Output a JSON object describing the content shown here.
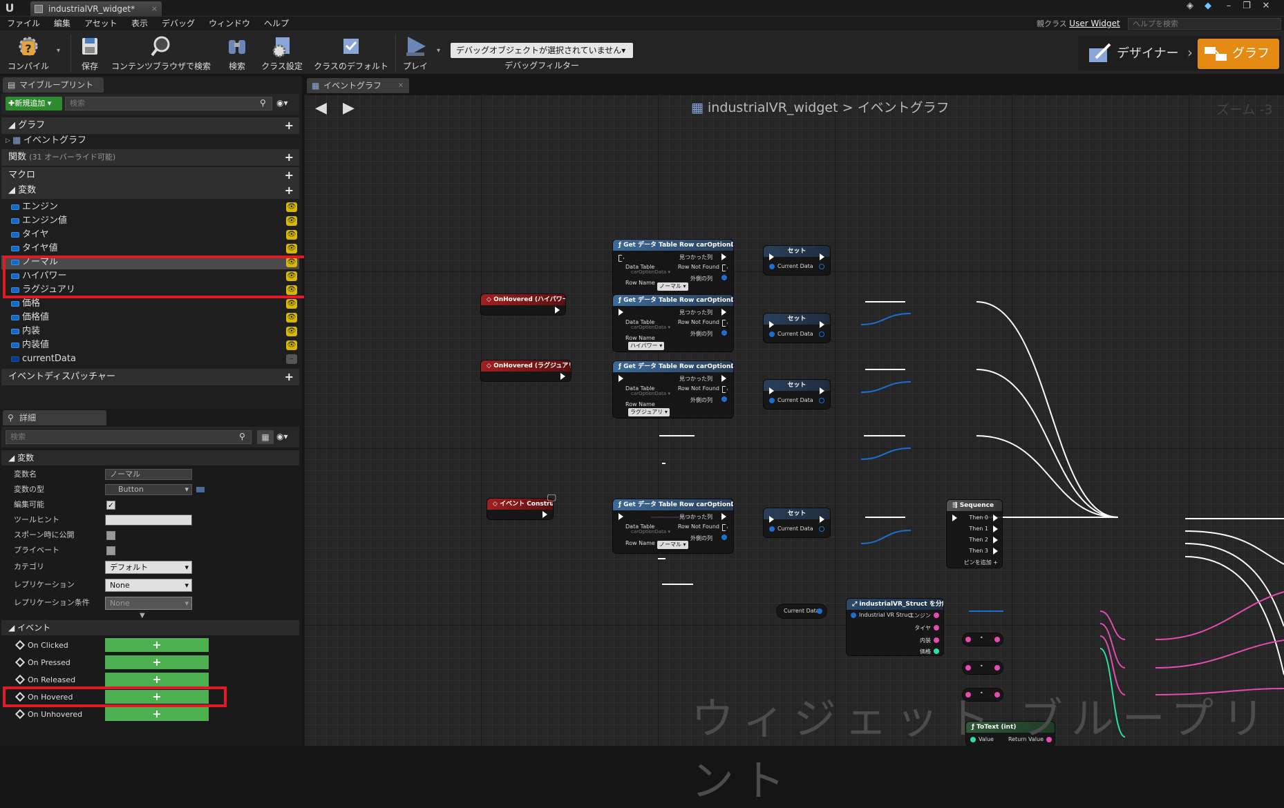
{
  "window": {
    "tab_title": "industrialVR_widget*",
    "close": "×"
  },
  "menu": [
    "ファイル",
    "編集",
    "アセット",
    "表示",
    "デバッグ",
    "ウィンドウ",
    "ヘルプ"
  ],
  "parent_class": {
    "label": "親クラス",
    "value": "User Widget"
  },
  "help_search_placeholder": "ヘルプを検索",
  "toolbar": {
    "compile": "コンパイル",
    "save": "保存",
    "content_browser": "コンテンツブラウザで検索",
    "search": "検索",
    "class_settings": "クラス設定",
    "class_defaults": "クラスのデフォルト",
    "play": "プレイ",
    "debug_select": "デバッグオブジェクトが選択されていません▾",
    "debug_filter": "デバッグフィルター"
  },
  "modes": {
    "designer": "デザイナー",
    "graph": "グラフ",
    "accent": "#e58b14"
  },
  "my_blueprint": {
    "tab": "マイブループリント",
    "add_new": "新規追加",
    "search_placeholder": "検索",
    "graphs_header": "グラフ",
    "event_graph": "イベントグラフ",
    "functions_header": "関数",
    "functions_note": "(31 オーバーライド可能)",
    "macros_header": "マクロ",
    "variables_header": "変数",
    "variables": [
      "エンジン",
      "エンジン値",
      "タイヤ",
      "タイヤ値",
      "ノーマル",
      "ハイパワー",
      "ラグジュアリ",
      "価格",
      "価格値",
      "内装",
      "内装値",
      "currentData"
    ],
    "dispatchers_header": "イベントディスパッチャー"
  },
  "details": {
    "tab": "詳細",
    "search_placeholder": "検索",
    "variable_header": "変数",
    "rows": {
      "var_name_label": "変数名",
      "var_name_value": "ノーマル",
      "var_type_label": "変数の型",
      "var_type_value": "Button",
      "editable_label": "編集可能",
      "tooltip_label": "ツールヒント",
      "expose_spawn_label": "スポーン時に公開",
      "private_label": "プライベート",
      "category_label": "カテゴリ",
      "category_value": "デフォルト",
      "replication_label": "レプリケーション",
      "replication_value": "None",
      "rep_condition_label": "レプリケーション条件",
      "rep_condition_value": "None"
    },
    "events_header": "イベント",
    "events": [
      "On Clicked",
      "On Pressed",
      "On Released",
      "On Hovered",
      "On Unhovered"
    ],
    "add_symbol": "+"
  },
  "graph": {
    "tab": "イベントグラフ",
    "breadcrumb_root": "industrialVR_widget",
    "breadcrumb_sep": ">",
    "breadcrumb_leaf": "イベントグラフ",
    "zoom": "ズーム -3",
    "watermark": "ウィジェット ブループリント",
    "get_row_title": "Get データ Table Row carOptionData",
    "pins": {
      "found": "見つかった列",
      "not_found": "Row Not Found",
      "out_row": "外側の列",
      "data_table": "Data Table",
      "data_table_value": "carOptionData ▾",
      "row_name": "Row Name"
    },
    "row_names": [
      "ノーマル ▾",
      "ハイパワー ▾",
      "ラグジュアリ ▾",
      "ノーマル ▾"
    ],
    "set_title": "セット",
    "current_data": "Current Data",
    "events": [
      "OnHovered (ハイパワー)",
      "OnHovered (ラグジュアリ)",
      "イベント Construct"
    ],
    "sequence": {
      "title": "Sequence",
      "outputs": [
        "Then 0",
        "Then 1",
        "Then 2",
        "Then 3"
      ],
      "add_pin": "ピンを追加 +"
    },
    "break_struct": {
      "title": "industrialVR_Struct を分解",
      "input": "Industrial VR Struct",
      "outputs": [
        "エンジン",
        "タイヤ",
        "内装",
        "価格"
      ]
    },
    "totext": {
      "title": "ToText (int)",
      "value": "Value",
      "return": "Return Value"
    }
  }
}
